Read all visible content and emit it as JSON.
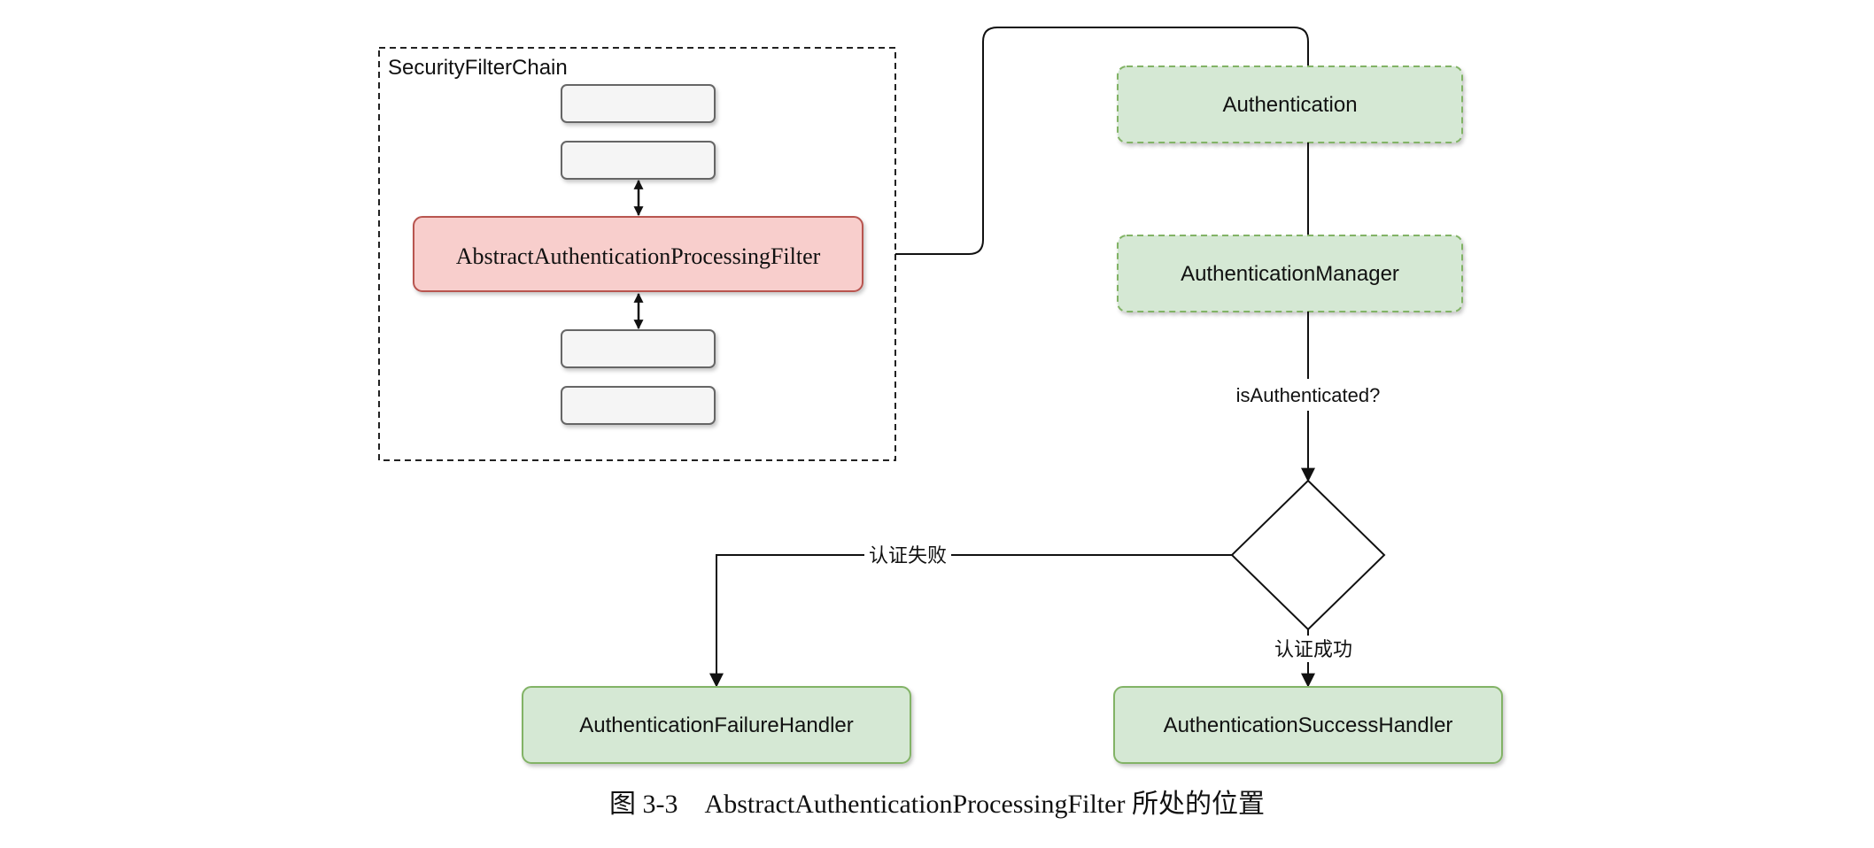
{
  "group": {
    "label": "SecurityFilterChain"
  },
  "filter": {
    "label": "AbstractAuthenticationProcessingFilter"
  },
  "nodes": {
    "authentication": "Authentication",
    "manager": "AuthenticationManager",
    "failure_handler": "AuthenticationFailureHandler",
    "success_handler": "AuthenticationSuccessHandler"
  },
  "edges": {
    "is_authenticated": "isAuthenticated?",
    "failure": "认证失败",
    "success": "认证成功"
  },
  "caption": "图 3-3    AbstractAuthenticationProcessingFilter 所处的位置",
  "colors": {
    "filter_fill": "#f8cecc",
    "filter_stroke": "#b85450",
    "node_fill": "#d5e8d4",
    "node_stroke": "#82b366",
    "placeholder_fill": "#f5f5f5",
    "placeholder_stroke": "#666666"
  }
}
